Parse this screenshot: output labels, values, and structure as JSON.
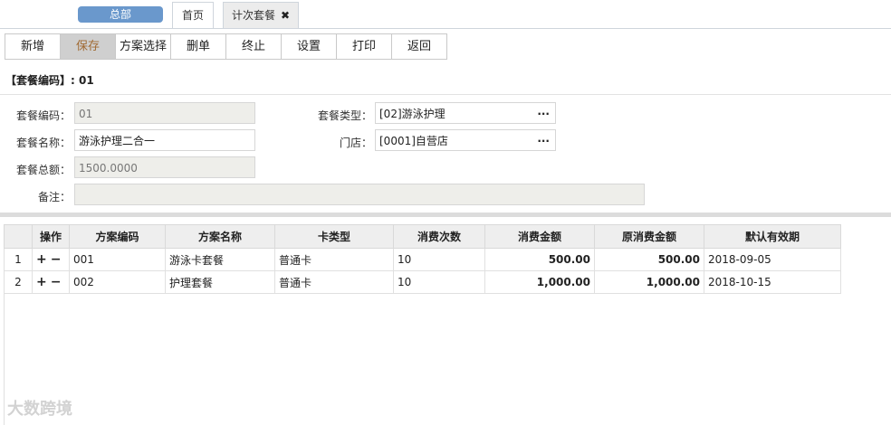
{
  "header": {
    "hq_label": "总部",
    "tabs": [
      {
        "label": "首页"
      },
      {
        "label": "计次套餐"
      }
    ],
    "close_glyph": "✖"
  },
  "toolbar": {
    "buttons": [
      "新增",
      "保存",
      "方案选择",
      "删单",
      "终止",
      "设置",
      "打印",
      "返回"
    ]
  },
  "code_line": {
    "label": "【套餐编码】:",
    "value": "01"
  },
  "form": {
    "code": {
      "label": "套餐编码：",
      "value": "01"
    },
    "name": {
      "label": "套餐名称：",
      "value": "游泳护理二合一"
    },
    "total": {
      "label": "套餐总额：",
      "value": "1500.0000"
    },
    "remark": {
      "label": "备注：",
      "value": ""
    },
    "type": {
      "label": "套餐类型：",
      "value": "[02]游泳护理"
    },
    "store": {
      "label": "门店：",
      "value": "[0001]自营店"
    },
    "lookup_glyph": "..."
  },
  "table": {
    "columns": [
      "",
      "操作",
      "方案编码",
      "方案名称",
      "卡类型",
      "消费次数",
      "消费金额",
      "原消费金额",
      "默认有效期"
    ],
    "rows": [
      {
        "idx": "1",
        "code": "001",
        "name": "游泳卡套餐",
        "card": "普通卡",
        "times": "10",
        "amount": "500.00",
        "orig": "500.00",
        "expiry": "2018-09-05"
      },
      {
        "idx": "2",
        "code": "002",
        "name": "护理套餐",
        "card": "普通卡",
        "times": "10",
        "amount": "1,000.00",
        "orig": "1,000.00",
        "expiry": "2018-10-15"
      }
    ],
    "op_add": "+",
    "op_remove": "−"
  },
  "watermark": "大数跨境"
}
